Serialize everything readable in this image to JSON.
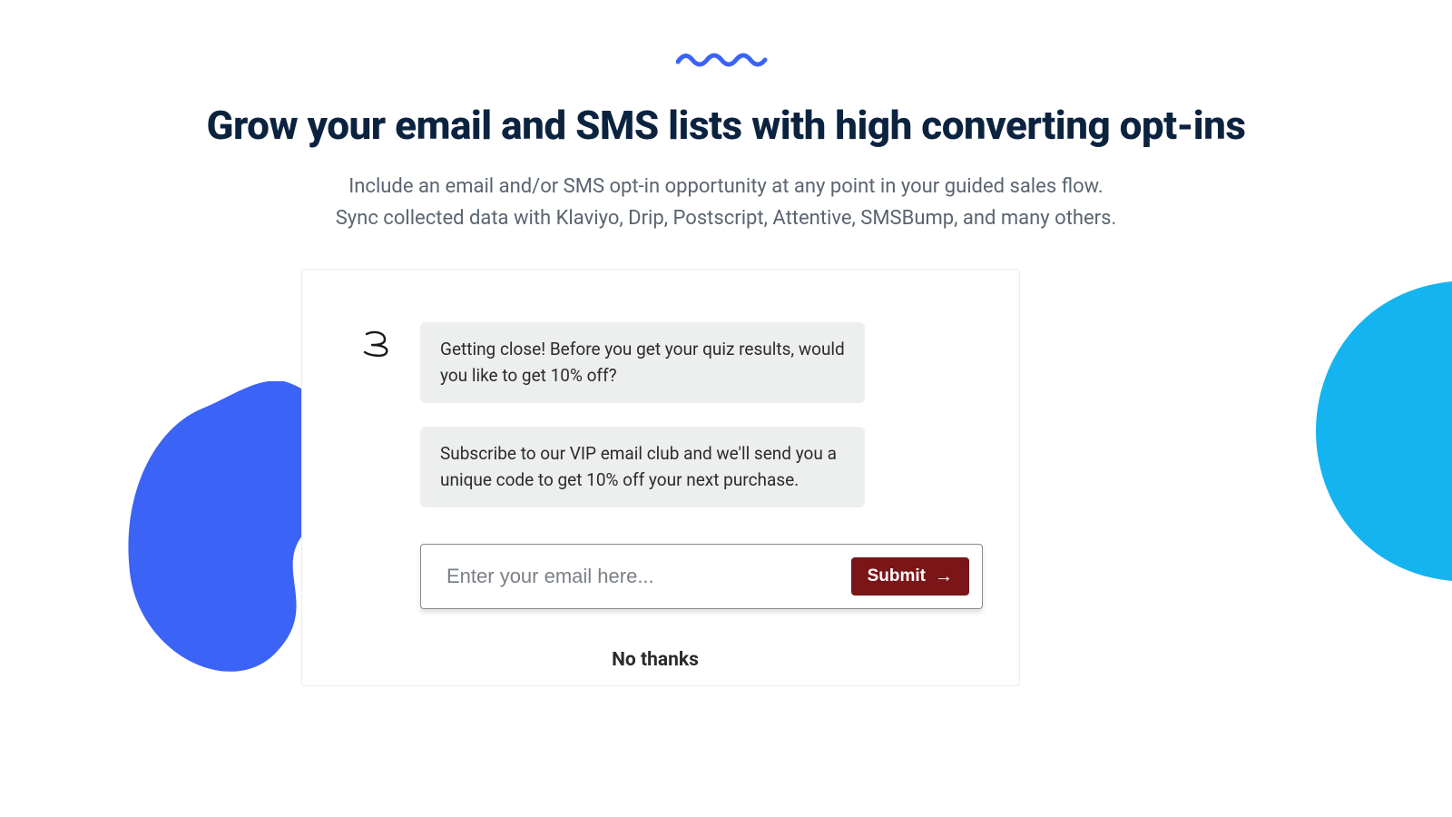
{
  "headline": "Grow your email and SMS lists with high converting opt-ins",
  "subtext_line1": "Include an email and/or SMS opt-in opportunity at any point in your guided sales flow.",
  "subtext_line2": "Sync collected data with Klaviyo, Drip, Postscript, Attentive, SMSBump, and many others.",
  "chat": {
    "bubble1": "Getting close! Before you get your quiz results, would you like to get 10% off?",
    "bubble2": "Subscribe to our VIP email club and we'll send you a unique code to get 10% off your next purchase."
  },
  "form": {
    "placeholder": "Enter your email here...",
    "submit_label": "Submit",
    "decline_label": "No thanks"
  },
  "colors": {
    "accent_blue": "#3b63f6",
    "cyan": "#14b4f0",
    "submit_bg": "#7a1518",
    "heading": "#0c2340"
  }
}
